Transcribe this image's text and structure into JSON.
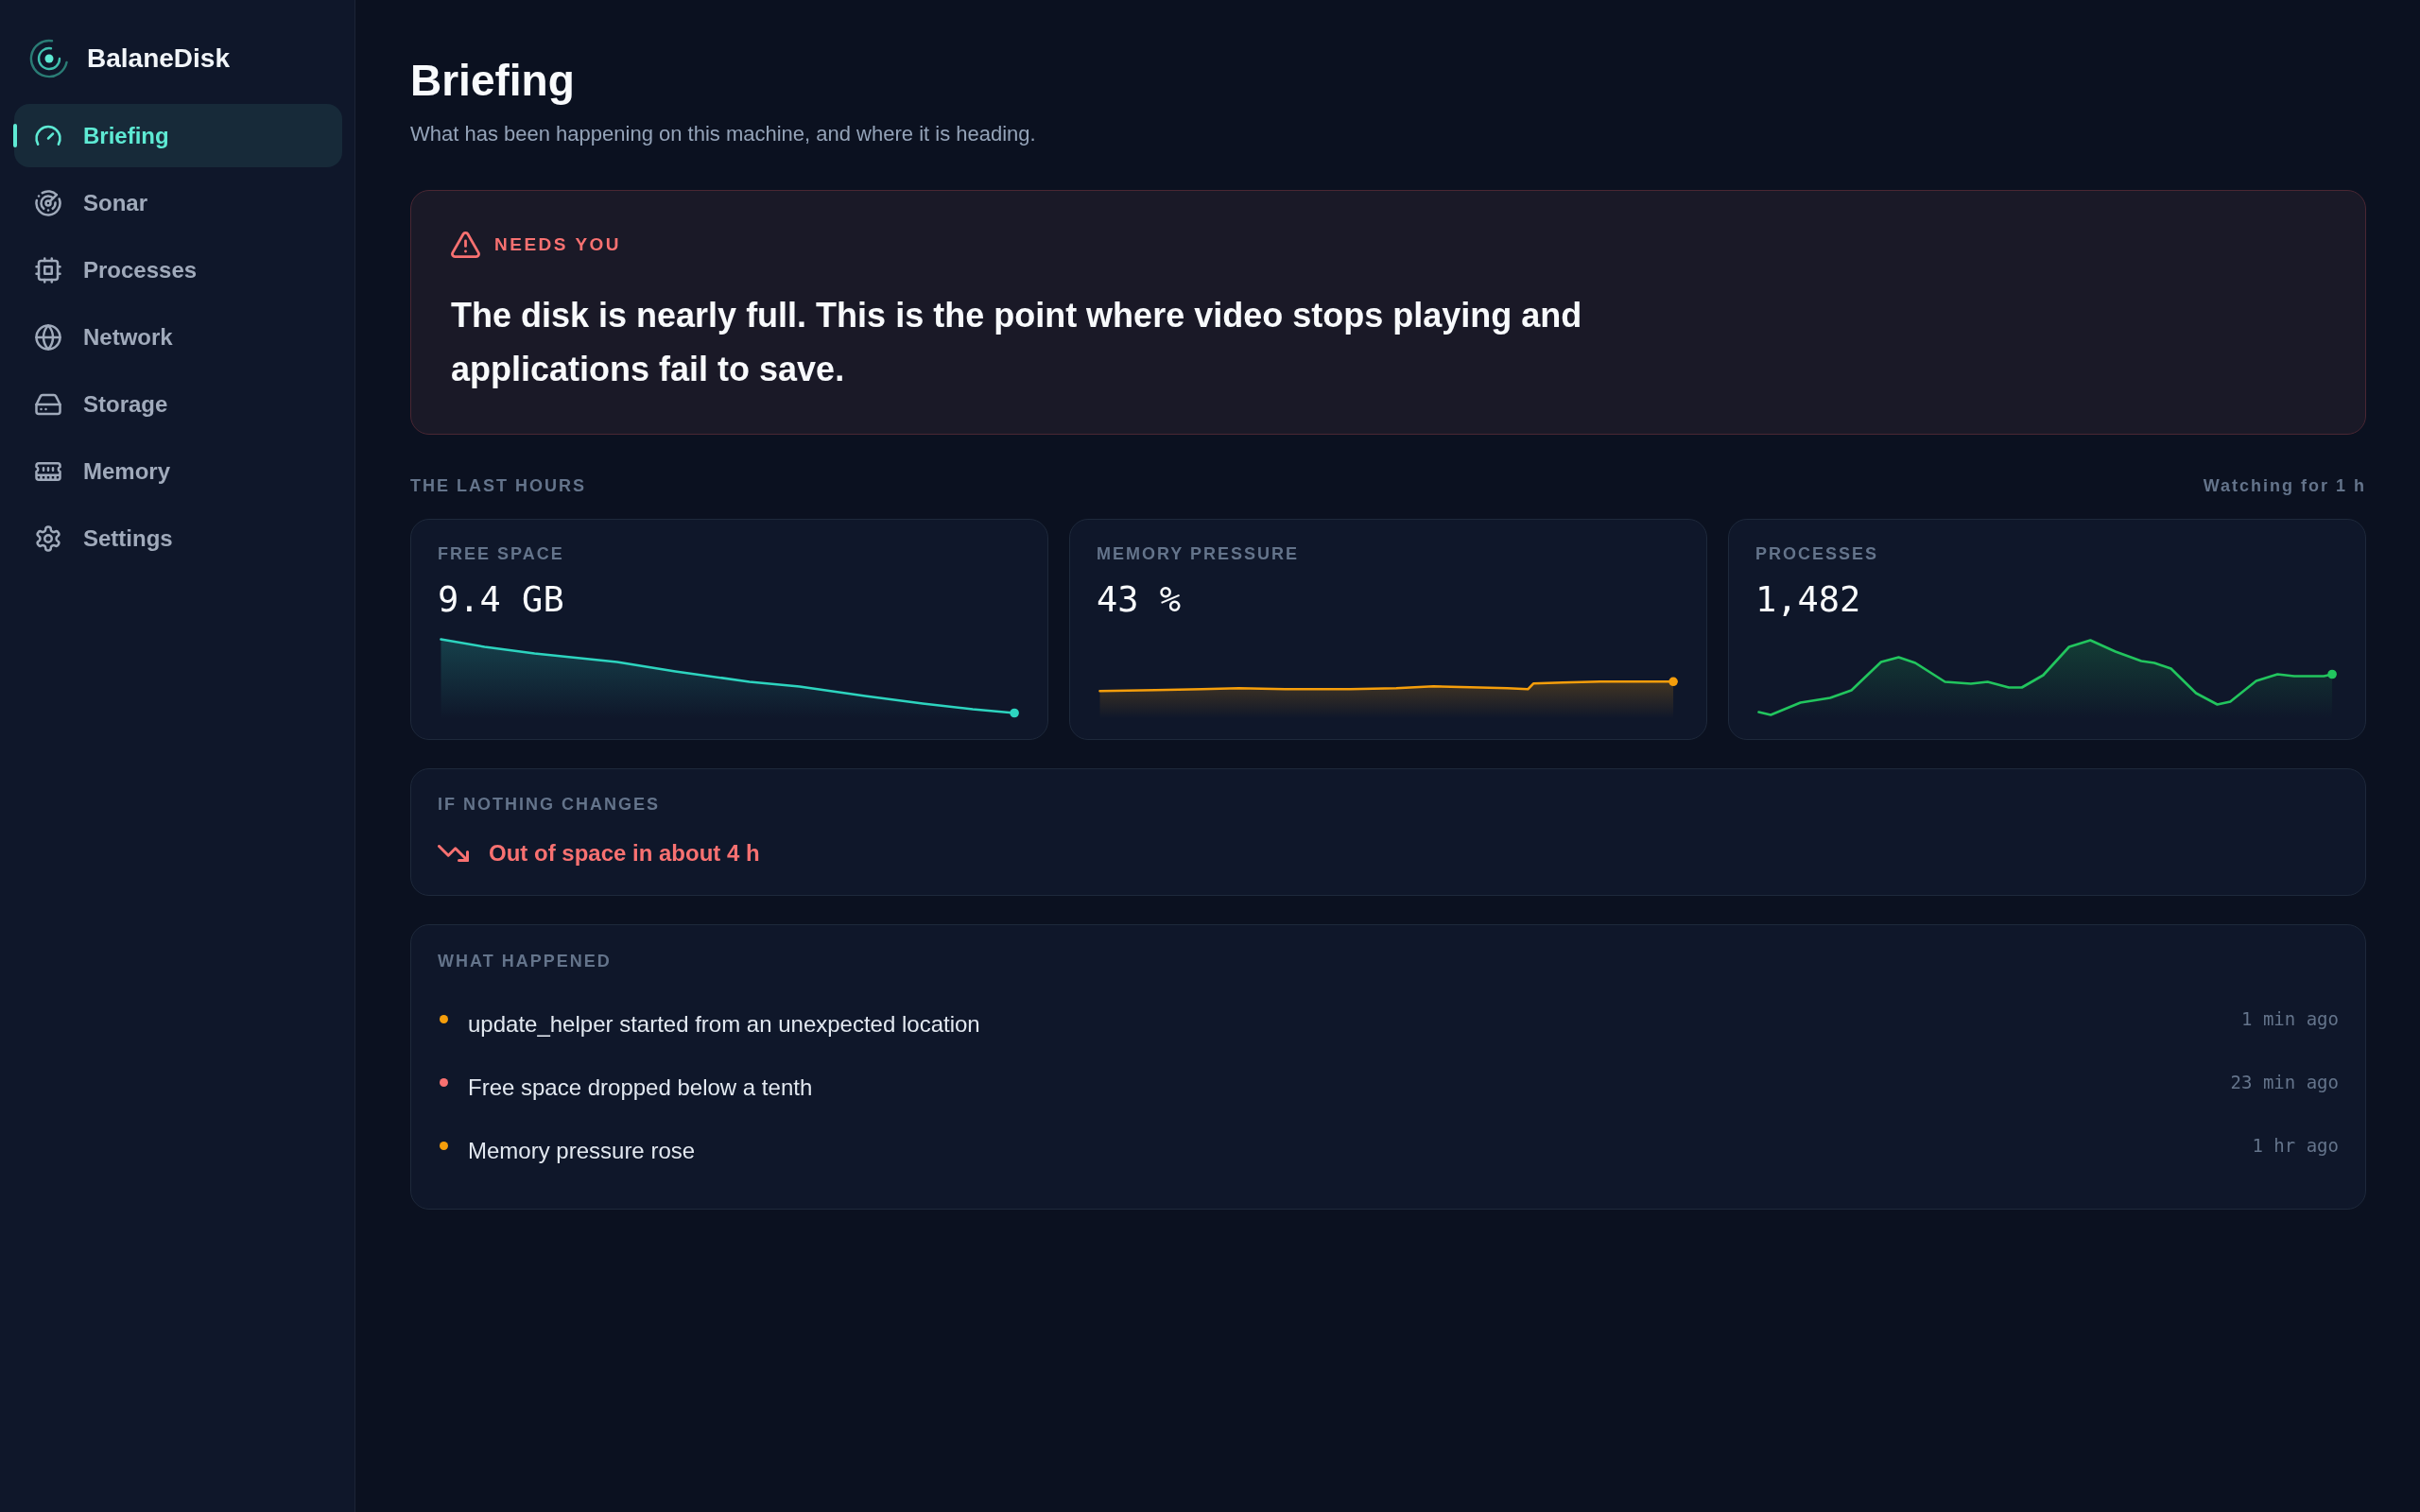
{
  "app": {
    "name": "BalaneDisk"
  },
  "sidebar": {
    "items": [
      {
        "label": "Briefing",
        "selected": true
      },
      {
        "label": "Sonar",
        "selected": false
      },
      {
        "label": "Processes",
        "selected": false
      },
      {
        "label": "Network",
        "selected": false
      },
      {
        "label": "Storage",
        "selected": false
      },
      {
        "label": "Memory",
        "selected": false
      },
      {
        "label": "Settings",
        "selected": false
      }
    ]
  },
  "header": {
    "title": "Briefing",
    "subtitle": "What has been happening on this machine, and where it is heading."
  },
  "alert": {
    "label": "NEEDS YOU",
    "message": "The disk is nearly full. This is the point where video stops playing and applications fail to save."
  },
  "recent": {
    "title": "THE LAST HOURS",
    "watching": "Watching for 1 h",
    "metrics": [
      {
        "label": "FREE SPACE",
        "value": "9.4 GB",
        "color": "#2dd4bf"
      },
      {
        "label": "MEMORY PRESSURE",
        "value": "43 %",
        "color": "#f59e0b"
      },
      {
        "label": "PROCESSES",
        "value": "1,482",
        "color": "#22c55e"
      }
    ]
  },
  "forecast": {
    "title": "IF NOTHING CHANGES",
    "text": "Out of space in about 4 h"
  },
  "events": {
    "title": "WHAT HAPPENED",
    "items": [
      {
        "text": "update_helper started from an unexpected location",
        "time": "1 min ago",
        "color": "#f59e0b"
      },
      {
        "text": "Free space dropped below a tenth",
        "time": "23 min ago",
        "color": "#f87171"
      },
      {
        "text": "Memory pressure rose",
        "time": "1 hr ago",
        "color": "#f59e0b"
      }
    ]
  }
}
